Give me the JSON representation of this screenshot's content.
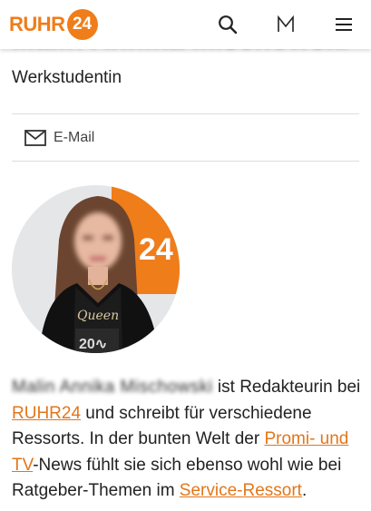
{
  "header": {
    "logo_text": "RUHR",
    "logo_number": "24",
    "search_icon": "search-icon",
    "merkliste_icon": "M",
    "menu_icon": "hamburger-menu-icon"
  },
  "profile": {
    "name": "Malin Annika Mischowski",
    "role": "Werkstudentin",
    "email_label": "E-Mail"
  },
  "bio": {
    "name_redacted": "Malin Annika Mischowski",
    "text_1": " ist Redakteurin bei ",
    "link_ruhr24": "RUHR24",
    "text_2": " und schreibt für verschiedene Ressorts. In der bunten Welt der ",
    "link_promi": "Promi- und TV",
    "text_3": "-News fühlt sie sich ebenso wohl wie bei Ratgeber-Themen im ",
    "link_service": "Service-Ressort",
    "text_4": "."
  },
  "colors": {
    "brand_orange": "#ef7d1a",
    "link_orange": "#e2761a"
  }
}
